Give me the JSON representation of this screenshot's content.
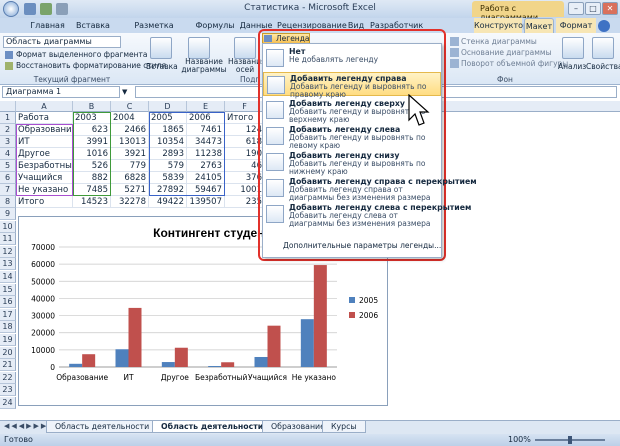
{
  "window": {
    "title": "Статистика - Microsoft Excel",
    "context_title": "Работа с диаграммами",
    "controls": [
      "–",
      "□",
      "✕"
    ]
  },
  "tabs": [
    "Главная",
    "Вставка",
    "Разметка страницы",
    "Формулы",
    "Данные",
    "Рецензирование",
    "Вид",
    "Разработчик",
    "Конструктор",
    "Макет",
    "Формат"
  ],
  "ribbon": {
    "selector": "Область диаграммы",
    "format_btn": "Формат выделенного фрагмента",
    "reset_btn": "Восстановить форматирование стиля",
    "group1": "Текущий фрагмент",
    "insert": "Вставка",
    "chart_title": "Название диаграммы",
    "axis_titles": "Названия осей",
    "group2": "Подп",
    "wall": "Стенка диаграммы",
    "floor": "Основание диаграммы",
    "rotate": "Поворот объемной фигуры",
    "group_bg": "Фон",
    "analysis": "Анализ",
    "props": "Свойства"
  },
  "namebox": "Диаграмма 1",
  "columns": [
    "A",
    "B",
    "C",
    "D",
    "E",
    "F"
  ],
  "rows": [
    {
      "n": "1",
      "a": "Работа",
      "b": "2003",
      "c": "2004",
      "d": "2005",
      "e": "2006",
      "f": "Итого"
    },
    {
      "n": "2",
      "a": "Образование",
      "b": "623",
      "c": "2466",
      "d": "1865",
      "e": "7461",
      "f": "124"
    },
    {
      "n": "3",
      "a": "ИТ",
      "b": "3991",
      "c": "13013",
      "d": "10354",
      "e": "34473",
      "f": "618"
    },
    {
      "n": "4",
      "a": "Другое",
      "b": "1016",
      "c": "3921",
      "d": "2893",
      "e": "11238",
      "f": "190"
    },
    {
      "n": "5",
      "a": "Безработный",
      "b": "526",
      "c": "779",
      "d": "579",
      "e": "2763",
      "f": "46"
    },
    {
      "n": "6",
      "a": "Учащийся",
      "b": "882",
      "c": "6828",
      "d": "5839",
      "e": "24105",
      "f": "376"
    },
    {
      "n": "7",
      "a": "Не указано",
      "b": "7485",
      "c": "5271",
      "d": "27892",
      "e": "59467",
      "f": "1001"
    },
    {
      "n": "8",
      "a": "Итого",
      "b": "14523",
      "c": "32278",
      "d": "49422",
      "e": "139507",
      "f": "235"
    }
  ],
  "extra_rows": [
    "9",
    "10",
    "11",
    "12",
    "13",
    "14",
    "15",
    "16",
    "17",
    "18",
    "19",
    "20",
    "21",
    "22",
    "23",
    "24"
  ],
  "legend_menu": {
    "button": "Легенда",
    "items": [
      {
        "title": "Нет",
        "desc": "Не добавлять легенду"
      },
      {
        "title": "Добавить легенду справа",
        "desc": "Добавить легенду и выровнять по правому краю"
      },
      {
        "title": "Добавить легенду сверху",
        "desc": "Добавить легенду и выровнять по верхнему краю"
      },
      {
        "title": "Добавить легенду слева",
        "desc": "Добавить легенду и выровнять по левому краю"
      },
      {
        "title": "Добавить легенду снизу",
        "desc": "Добавить легенду и выровнять по нижнему краю"
      },
      {
        "title": "Добавить легенду справа с перекрытием",
        "desc": "Добавить легенду справа от диаграммы без изменения размера"
      },
      {
        "title": "Добавить легенду слева с перекрытием",
        "desc": "Добавить легенду слева от диаграммы без изменения размера"
      }
    ],
    "more": "Дополнительные параметры легенды..."
  },
  "sheets": [
    "Область деятельности (2)",
    "Область деятельности (3)",
    "Образование",
    "Курсы"
  ],
  "status": "Готово",
  "zoom": "100%",
  "chart_data": {
    "type": "bar",
    "title": "Контингент студентов",
    "categories": [
      "Образование",
      "ИТ",
      "Другое",
      "Безработный",
      "Учащийся",
      "Не указано"
    ],
    "series": [
      {
        "name": "2005",
        "values": [
          1865,
          10354,
          2893,
          579,
          5839,
          27892
        ],
        "color": "#4f81bd"
      },
      {
        "name": "2006",
        "values": [
          7461,
          34473,
          11238,
          2763,
          24105,
          59467
        ],
        "color": "#c0504d"
      }
    ],
    "ylim": [
      0,
      70000
    ],
    "yticks": [
      0,
      10000,
      20000,
      30000,
      40000,
      50000,
      60000,
      70000
    ],
    "grid": true,
    "legend": "right"
  }
}
